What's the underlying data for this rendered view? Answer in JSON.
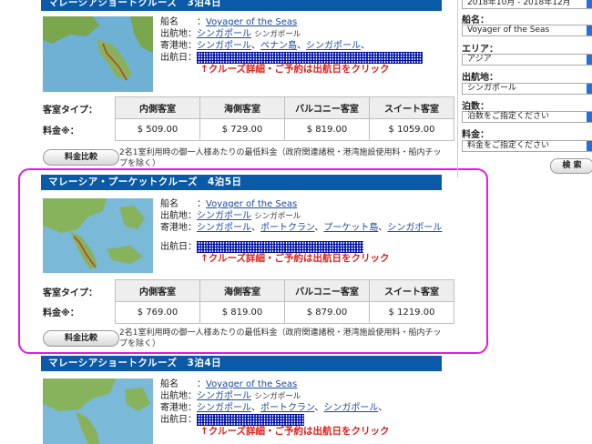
{
  "sidebar": {
    "period_value": "2018年10月 - 2018年12月",
    "ship_label": "船名：",
    "ship_value": "Voyager of the Seas",
    "area_label": "エリア：",
    "area_value": "アジア",
    "port_label": "出航地：",
    "port_value": "シンガポール",
    "nights_label": "泊数：",
    "nights_value": "泊数をご指定ください",
    "fare_label": "料金：",
    "fare_value": "料金をご指定ください",
    "search_label": "検 索"
  },
  "labels": {
    "ship": "船名",
    "departure": "出航地：",
    "ports": "寄港地：",
    "date": "出航日：",
    "cta": "↑クルーズ詳細・ご予約は出航日をクリック",
    "room_type": "客室タイプ：",
    "price": "料金※：",
    "compare_button": "料金比較",
    "note": "2名1室利用時の御一人様あたりの最低料金（政府関連諸税・港湾施設使用料・船内チップを除く）",
    "colon": "："
  },
  "room_headers": [
    "内側客室",
    "海側客室",
    "バルコニー客室",
    "スイート客室"
  ],
  "cruises": [
    {
      "title": "マレーシアショートクルーズ　3泊4日",
      "ship": "Voyager of the Seas",
      "departure": "シンガポール",
      "departure_small": "シンガポール",
      "ports": [
        "シンガポール",
        "ペナン島",
        "シンガポール"
      ],
      "prices": [
        "$ 509.00",
        "$ 729.00",
        "$ 819.00",
        "$ 1059.00"
      ]
    },
    {
      "title": "マレーシア・プーケットクルーズ　4泊5日",
      "ship": "Voyager of the Seas",
      "departure": "シンガポール",
      "departure_small": "シンガポール",
      "ports": [
        "シンガポール",
        "ポートクラン",
        "プーケット島",
        "シンガポール"
      ],
      "prices": [
        "$ 769.00",
        "$ 819.00",
        "$ 879.00",
        "$ 1219.00"
      ]
    },
    {
      "title": "マレーシアショートクルーズ　3泊4日",
      "ship": "Voyager of the Seas",
      "departure": "シンガポール",
      "departure_small": "シンガポール",
      "ports": [
        "シンガポール",
        "ポートクラン",
        "シンガポール"
      ]
    }
  ]
}
